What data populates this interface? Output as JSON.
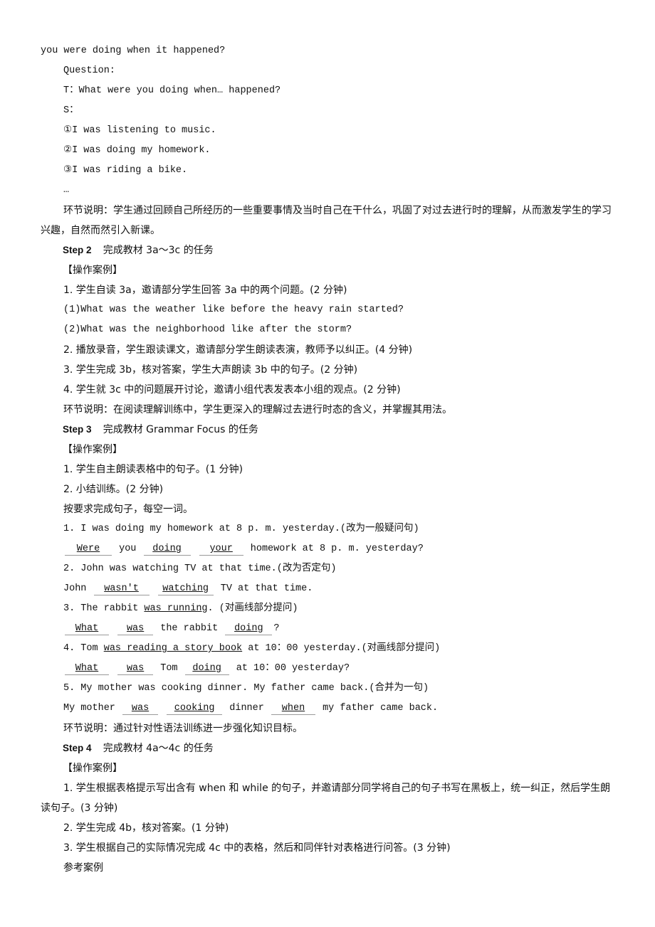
{
  "intro": {
    "continuation": "you were doing when it happened?",
    "question_label": "Question:",
    "teacher": "T：What were you doing when… happened?",
    "student_label": "S：",
    "answers": [
      "①I was listening to music.",
      "②I was doing my homework.",
      "③I was riding a bike."
    ],
    "ellipsis": "…",
    "note": "环节说明：学生通过回顾自己所经历的一些重要事情及当时自己在干什么，巩固了对过去进行时的理解，从而激发学生的学习兴趣，自然而然引入新课。"
  },
  "step2": {
    "title_step": "Step 2",
    "title_text": "完成教材 3a～3c 的任务",
    "case_label": "【操作案例】",
    "items": [
      "1. 学生自读 3a，邀请部分学生回答 3a 中的两个问题。(2 分钟)",
      "(1)What was the weather like before the heavy rain started?",
      "(2)What was the neighborhood like after the storm?",
      "2. 播放录音，学生跟读课文，邀请部分学生朗读表演，教师予以纠正。(4 分钟)",
      "3. 学生完成 3b，核对答案，学生大声朗读 3b 中的句子。(2 分钟)",
      "4. 学生就 3c 中的问题展开讨论，邀请小组代表发表本小组的观点。(2 分钟)"
    ],
    "note": "环节说明：在阅读理解训练中，学生更深入的理解过去进行时态的含义，并掌握其用法。"
  },
  "step3": {
    "title_step": "Step 3",
    "title_text": "完成教材 Grammar Focus 的任务",
    "case_label": "【操作案例】",
    "items": [
      "1. 学生自主朗读表格中的句子。(1 分钟)",
      "2. 小结训练。(2 分钟)"
    ],
    "instruction": "按要求完成句子，每空一词。",
    "exercises": [
      {
        "prompt": "1. I was doing my homework at 8 p. m. yesterday.(改为一般疑问句)",
        "answer_parts": [
          "Were",
          "you",
          "doing",
          "your",
          "homework at 8 p. m. yesterday?"
        ]
      },
      {
        "prompt": "2. John was watching TV at that time.(改为否定句)",
        "answer_parts": [
          "John",
          "wasn't",
          "watching",
          "TV at that time."
        ]
      },
      {
        "prompt_parts": [
          "3. The rabbit ",
          "was  running",
          ". (对画线部分提问)"
        ],
        "answer_parts": [
          "What",
          "was",
          "the rabbit",
          "doing",
          "?"
        ]
      },
      {
        "prompt_parts": [
          "4. Tom ",
          "was  reading  a  story  book",
          " at 10：00 yesterday.(对画线部分提问)"
        ],
        "answer_parts": [
          "What",
          "was",
          "Tom",
          "doing",
          "at 10：00 yesterday?"
        ]
      },
      {
        "prompt": "5. My mother was cooking dinner. My father came back.(合并为一句)",
        "answer_parts": [
          "My mother",
          "was",
          "cooking",
          "dinner",
          "when",
          "my father came back."
        ]
      }
    ],
    "note": "环节说明：通过针对性语法训练进一步强化知识目标。"
  },
  "step4": {
    "title_step": "Step 4",
    "title_text": "完成教材 4a～4c 的任务",
    "case_label": "【操作案例】",
    "items": [
      "1. 学生根据表格提示写出含有 when 和 while 的句子，并邀请部分同学将自己的句子书写在黑板上，统一纠正，然后学生朗读句子。(3 分钟)",
      "2. 学生完成 4b，核对答案。(1 分钟)",
      "3. 学生根据自己的实际情况完成 4c 中的表格，然后和同伴针对表格进行问答。(3 分钟)"
    ],
    "reference": "参考案例"
  }
}
